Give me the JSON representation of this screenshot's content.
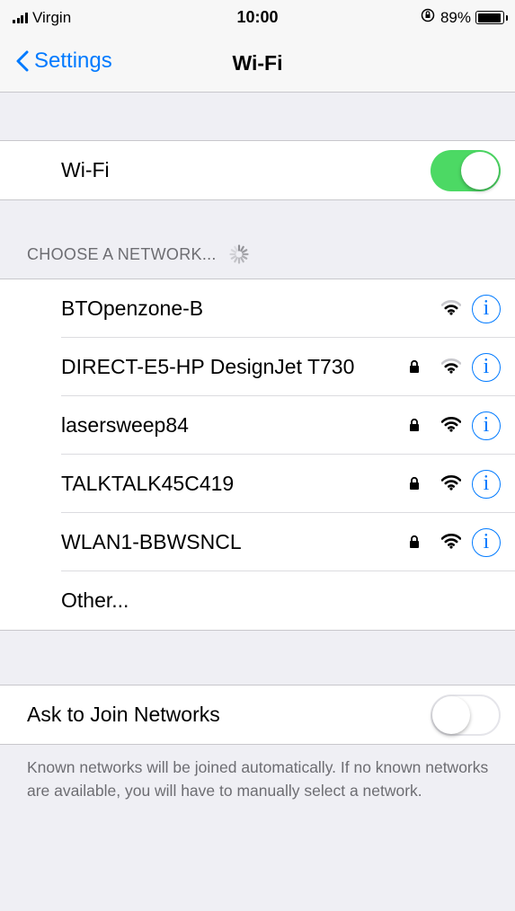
{
  "status_bar": {
    "carrier": "Virgin",
    "time": "10:00",
    "battery": "89%",
    "battery_level": 0.89
  },
  "nav": {
    "back_label": "Settings",
    "title": "Wi-Fi"
  },
  "wifi": {
    "label": "Wi-Fi",
    "enabled": true
  },
  "networks_section": {
    "header": "CHOOSE A NETWORK...",
    "networks": [
      {
        "name": "BTOpenzone-B",
        "secured": false,
        "signal": "medium"
      },
      {
        "name": "DIRECT-E5-HP DesignJet T730",
        "secured": true,
        "signal": "medium"
      },
      {
        "name": "lasersweep84",
        "secured": true,
        "signal": "full"
      },
      {
        "name": "TALKTALK45C419",
        "secured": true,
        "signal": "full"
      },
      {
        "name": "WLAN1-BBWSNCL",
        "secured": true,
        "signal": "full"
      }
    ],
    "other_label": "Other..."
  },
  "ask_to_join": {
    "label": "Ask to Join Networks",
    "enabled": false,
    "footer": "Known networks will be joined automatically. If no known networks are available, you will have to manually select a network."
  },
  "colors": {
    "accent": "#007aff",
    "toggle_on": "#4cd964",
    "background": "#efeff4",
    "secondary_text": "#6d6d72"
  }
}
